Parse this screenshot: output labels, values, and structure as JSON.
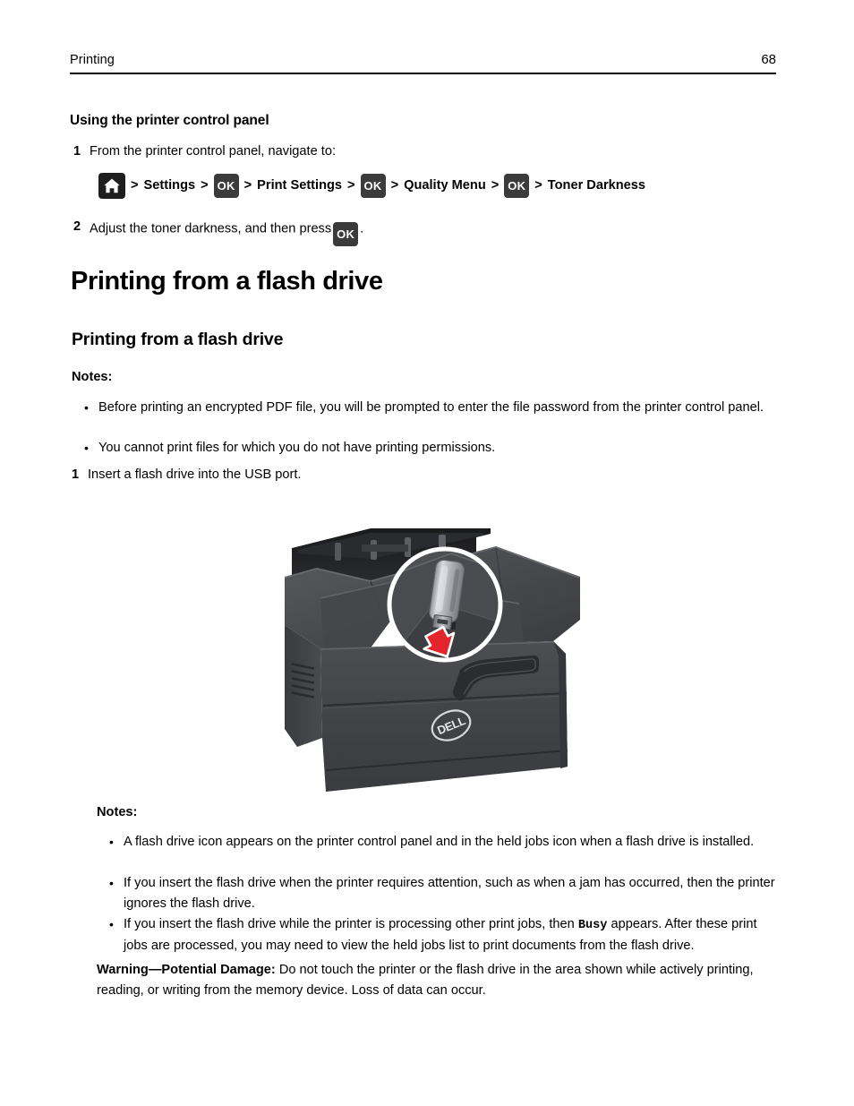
{
  "header": {
    "section_title": "Printing",
    "page_number": "68"
  },
  "control_panel_section": {
    "heading": "Using the printer control panel",
    "step1": {
      "number": "1",
      "text": "From the printer control panel, navigate to:"
    },
    "nav_path": {
      "home_icon": "home-icon",
      "separator": ">",
      "ok_label": "OK",
      "items": [
        {
          "type": "icon",
          "value": "home-icon"
        },
        {
          "type": "text",
          "value": "Settings"
        },
        {
          "type": "key",
          "value": "OK"
        },
        {
          "type": "text",
          "value": "Print Settings"
        },
        {
          "type": "key",
          "value": "OK"
        },
        {
          "type": "text",
          "value": "Quality Menu"
        },
        {
          "type": "key",
          "value": "OK"
        },
        {
          "type": "text",
          "value": "Toner Darkness"
        }
      ],
      "label_settings": "Settings",
      "label_print_settings": "Print Settings",
      "label_quality_menu": "Quality Menu",
      "label_toner_darkness": "Toner Darkness"
    },
    "step2": {
      "number": "2",
      "text_before": "Adjust the toner darkness, and then press",
      "key": "OK",
      "text_after": "."
    }
  },
  "main_heading": "Printing from a flash drive",
  "sub_heading": "Printing from a flash drive",
  "notes_top": {
    "label": "Notes:",
    "bullets": [
      "Before printing an encrypted PDF file, you will be prompted to enter the file password from the printer control panel.",
      "You cannot print files for which you do not have printing permissions."
    ]
  },
  "step_insert": {
    "number": "1",
    "text": "Insert a flash drive into the USB port."
  },
  "illustration": {
    "name": "dell-printer-usb-insert",
    "brand_logo": "DELL",
    "callout": "usb-flash-drive-insertion-zoom",
    "arrow_color": "#e4252c",
    "printer_body_color": "#3f4042",
    "flash_drive_color": "#b9bcc0"
  },
  "notes_bottom": {
    "label": "Notes:",
    "bullets": [
      "A flash drive icon appears on the printer control panel and in the held jobs icon when a flash drive is installed.",
      "If you insert the flash drive when the printer requires attention, such as when a jam has occurred, then the printer ignores the flash drive."
    ],
    "bullet_busy": {
      "before": "If you insert the flash drive while the printer is processing other print jobs, then",
      "code": "Busy",
      "after": "appears. After these print jobs are processed, you may need to view the held jobs list to print documents from the flash drive."
    }
  },
  "warning": {
    "label": "Warning—Potential Damage:",
    "text": "Do not touch the printer or the flash drive in the area shown while actively printing, reading, or writing from the memory device. Loss of data can occur."
  }
}
